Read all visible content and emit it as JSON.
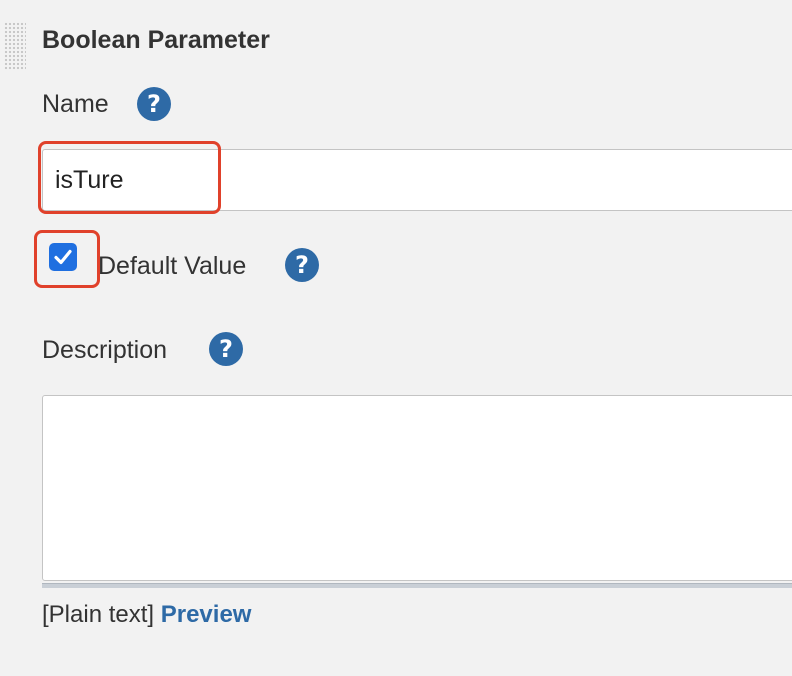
{
  "section": {
    "title": "Boolean Parameter"
  },
  "name_field": {
    "label": "Name",
    "value": "isTure",
    "help_icon": "question-mark-icon"
  },
  "default_value_field": {
    "label": "Default Value",
    "checked": true,
    "help_icon": "question-mark-icon"
  },
  "description_field": {
    "label": "Description",
    "value": "",
    "help_icon": "question-mark-icon"
  },
  "footer": {
    "format_note": "[Plain text]",
    "preview_link": "Preview"
  },
  "colors": {
    "help_icon": "#2e6aa6",
    "checkbox": "#1f6fe0",
    "highlight": "#e0412b",
    "link": "#2e6aa6"
  }
}
